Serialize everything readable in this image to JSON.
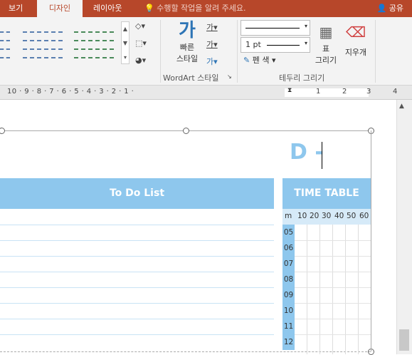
{
  "tabs": {
    "view": "보기",
    "design": "디자인",
    "layout": "레이아웃"
  },
  "tell_me": "수행할 작업을 알려 주세요.",
  "share": "공유",
  "ribbon": {
    "quick_style": "빠른\n스타일",
    "quick_style_l1": "빠른",
    "quick_style_l2": "스타일",
    "wordart_group": "WordArt 스타일",
    "pen_weight": "1 pt",
    "pen_color": "펜 색",
    "draw_table_l1": "표",
    "draw_table_l2": "그리기",
    "eraser": "지우개",
    "borders_group": "테두리 그리기"
  },
  "ruler": {
    "marks": "10 · 9 · 8 · 7 · 6 · 5 · 4 · 3 · 2 · 1 ·",
    "right_marks": [
      "1",
      "2",
      "3",
      "4"
    ]
  },
  "document": {
    "title": "D -",
    "todo_header": "To Do List",
    "timetable_header": "TIME TABLE",
    "minute_label": "m",
    "minutes": [
      "10",
      "20",
      "30",
      "40",
      "50",
      "60"
    ],
    "hours": [
      "05",
      "06",
      "07",
      "08",
      "09",
      "10",
      "11",
      "12"
    ]
  },
  "colors": {
    "accent": "#b7472a",
    "table_blue": "#8ec7ed",
    "sub_blue": "#d6eaf8"
  }
}
